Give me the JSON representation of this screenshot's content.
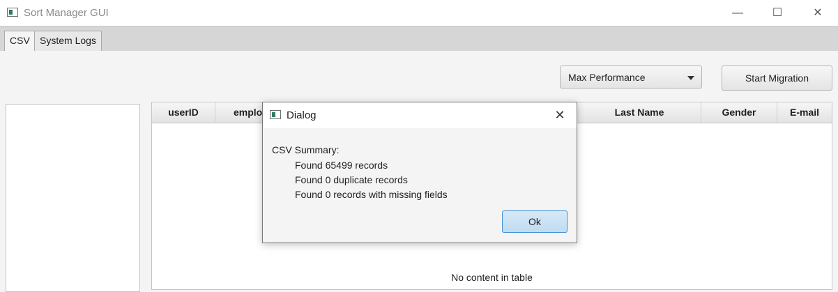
{
  "window": {
    "title": "Sort Manager GUI",
    "controls": {
      "minimize": "—",
      "maximize": "☐",
      "close": "✕"
    }
  },
  "tabs": [
    {
      "label": "CSV",
      "active": true
    },
    {
      "label": "System Logs",
      "active": false
    }
  ],
  "toolbar": {
    "mode_select": {
      "value": "Max Performance"
    },
    "start_button": "Start Migration"
  },
  "table": {
    "columns": [
      "userID",
      "emplo",
      "",
      "Last Name",
      "Gender",
      "E-mail"
    ],
    "empty_message": "No content in table"
  },
  "dialog": {
    "title": "Dialog",
    "close": "✕",
    "summary_title": "CSV Summary:",
    "lines": [
      "Found 65499 records",
      "Found 0 duplicate records",
      "Found 0 records with missing fields"
    ],
    "ok_label": "Ok"
  }
}
